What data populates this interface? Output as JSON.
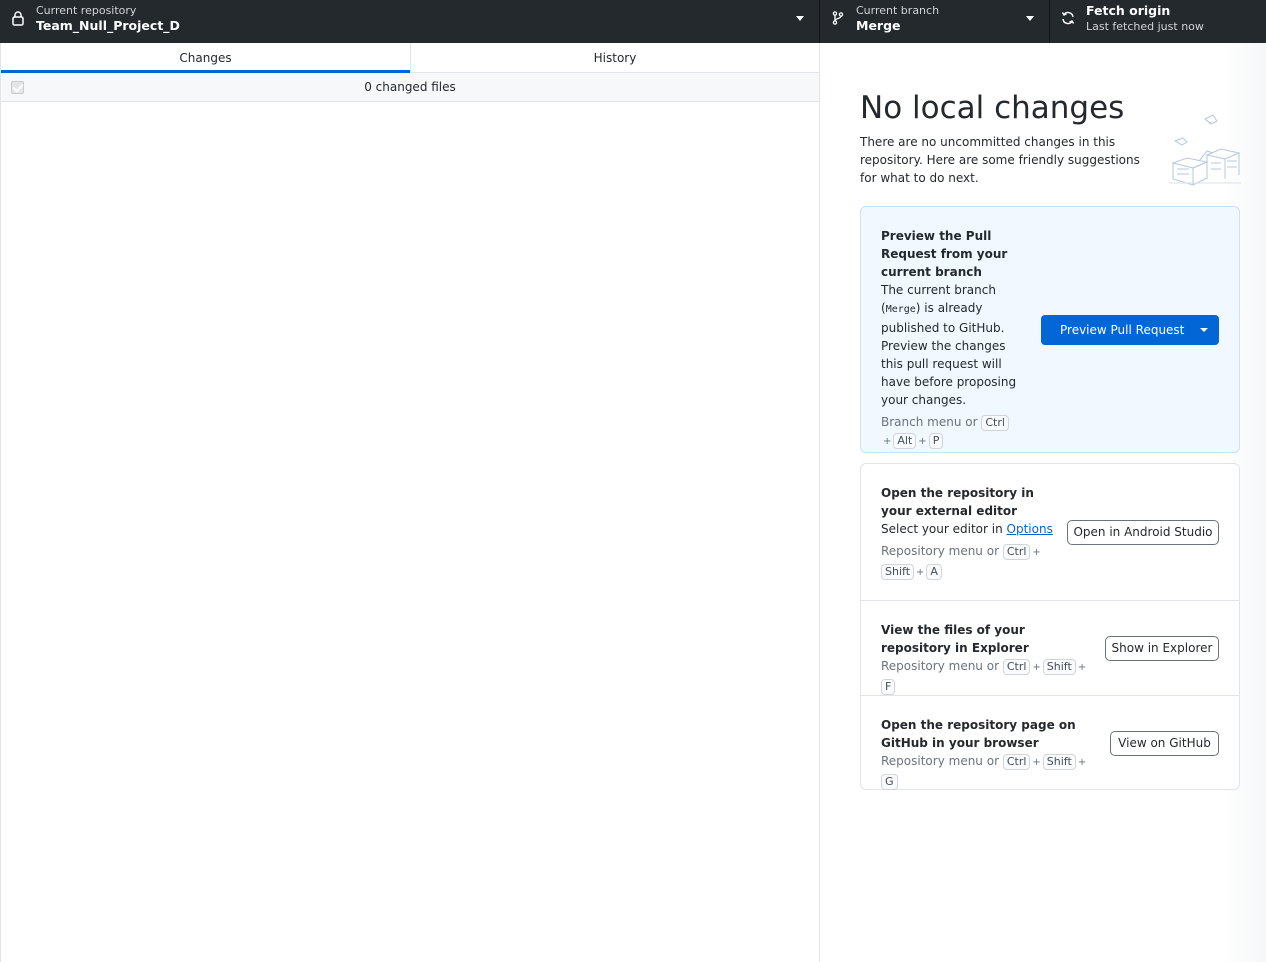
{
  "toolbar": {
    "repository": {
      "small_label": "Current repository",
      "name": "Team_Null_Project_D"
    },
    "branch": {
      "small_label": "Current branch",
      "name": "Merge"
    },
    "fetch": {
      "title": "Fetch origin",
      "subtitle": "Last fetched just now"
    }
  },
  "left": {
    "tabs": [
      {
        "label": "Changes",
        "active": true
      },
      {
        "label": "History",
        "active": false
      }
    ],
    "changed_files": "0 changed files"
  },
  "right": {
    "title": "No local changes",
    "subtitle": "There are no uncommitted changes in this repository. Here are some friendly suggestions for what to do next.",
    "primary_card": {
      "title": "Preview the Pull Request from your current branch",
      "desc_before": "The current branch (",
      "branch_code": "Merge",
      "desc_after": ") is already published to GitHub. Preview the changes this pull request will have before proposing your changes.",
      "hint_prefix": "Branch menu or",
      "shortcut": [
        "Ctrl",
        "Alt",
        "P"
      ],
      "button_label": "Preview Pull Request"
    },
    "suggestions": [
      {
        "title": "Open the repository in your external editor",
        "desc_prefix": "Select your editor in",
        "desc_link": "Options",
        "hint_prefix": "Repository menu or",
        "shortcut": [
          "Ctrl",
          "Shift",
          "A"
        ],
        "button_label": "Open in Android Studio"
      },
      {
        "title": "View the files of your repository in Explorer",
        "hint_prefix": "Repository menu or",
        "shortcut": [
          "Ctrl",
          "Shift",
          "F"
        ],
        "button_label": "Show in Explorer"
      },
      {
        "title": "Open the repository page on GitHub in your browser",
        "hint_prefix": "Repository menu or",
        "shortcut": [
          "Ctrl",
          "Shift",
          "G"
        ],
        "button_label": "View on GitHub"
      }
    ]
  },
  "colors": {
    "toolbar_bg": "#24292e",
    "accent": "#0366d6",
    "primary_card_bg": "#f1f8ff"
  },
  "icons": {
    "repo": "lock-icon",
    "branch": "git-branch-icon",
    "fetch": "sync-icon"
  }
}
